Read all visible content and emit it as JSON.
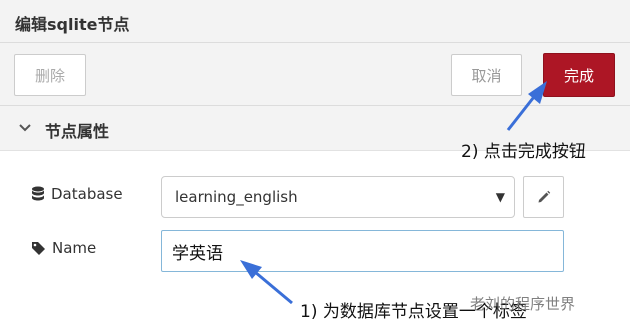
{
  "tray": {
    "title": "编辑sqlite节点"
  },
  "toolbar": {
    "delete_label": "删除",
    "cancel_label": "取消",
    "done_label": "完成"
  },
  "section": {
    "title": "节点属性"
  },
  "form": {
    "database": {
      "label": "Database",
      "value": "learning_english"
    },
    "name": {
      "label": "Name",
      "value": "学英语"
    }
  },
  "annotations": {
    "note_done": "2) 点击完成按钮",
    "note_name": "1) 为数据库节点设置一个标签"
  },
  "watermark": "老刘的程序世界",
  "colors": {
    "accent": "#ad1625",
    "arrow": "#3a6fd8"
  }
}
